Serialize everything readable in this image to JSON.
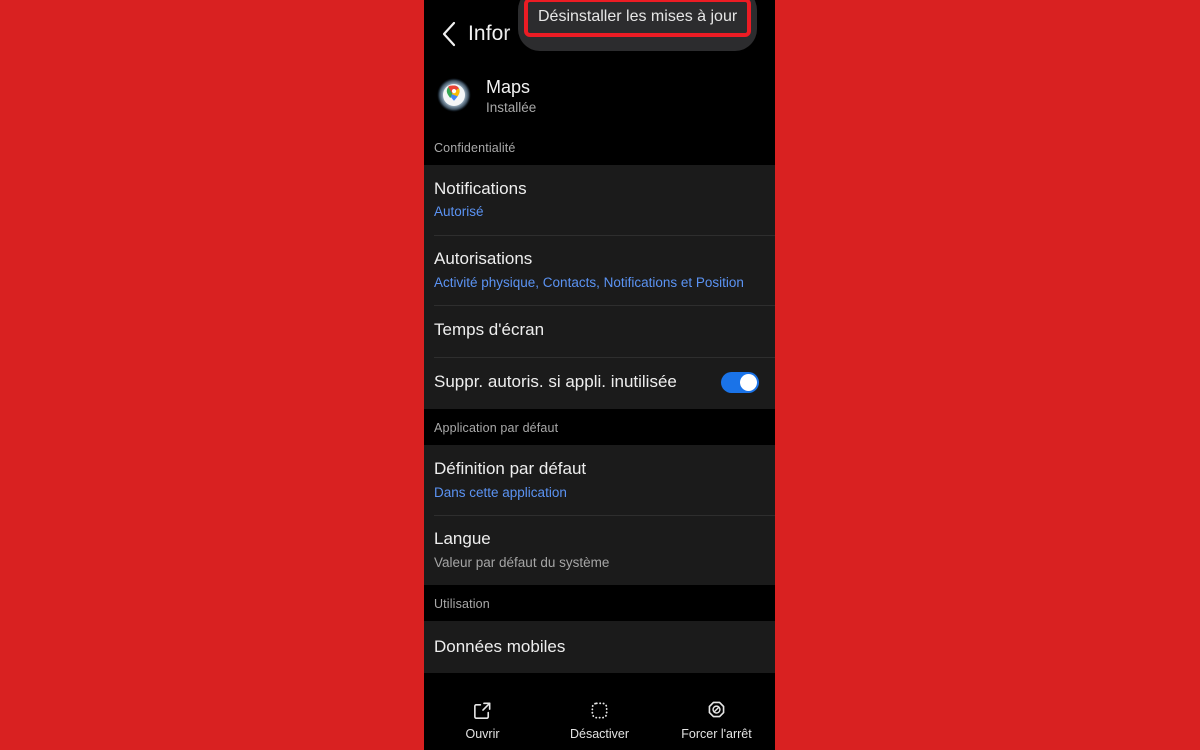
{
  "background_color": "#d92121",
  "accent_blue": "#5b93f3",
  "toggle_color": "#1a73e8",
  "highlight_color": "#ec1c24",
  "appbar": {
    "back_icon": "chevron-left-icon",
    "title": "Infor"
  },
  "popup": {
    "items": [
      {
        "label": "Désinstaller les mises à jour",
        "highlighted": true
      }
    ]
  },
  "app": {
    "icon": "google-maps-icon",
    "name": "Maps",
    "state": "Installée"
  },
  "sections": [
    {
      "header": "Confidentialité",
      "rows": [
        {
          "title": "Notifications",
          "subtitle": "Autorisé",
          "subtitle_style": "blue",
          "control": "none"
        },
        {
          "title": "Autorisations",
          "subtitle": "Activité physique, Contacts, Notifications et Position",
          "subtitle_style": "blue",
          "control": "none"
        },
        {
          "title": "Temps d'écran",
          "subtitle": "",
          "subtitle_style": "none",
          "control": "none"
        },
        {
          "title": "Suppr. autoris. si appli. inutilisée",
          "subtitle": "",
          "subtitle_style": "none",
          "control": "toggle",
          "toggle_on": true
        }
      ]
    },
    {
      "header": "Application par défaut",
      "rows": [
        {
          "title": "Définition par défaut",
          "subtitle": "Dans cette application",
          "subtitle_style": "blue",
          "control": "none"
        },
        {
          "title": "Langue",
          "subtitle": "Valeur par défaut du système",
          "subtitle_style": "grey",
          "control": "none"
        }
      ]
    },
    {
      "header": "Utilisation",
      "rows": [
        {
          "title": "Données mobiles",
          "subtitle": "",
          "subtitle_style": "none",
          "control": "none"
        }
      ]
    }
  ],
  "actionbar": {
    "actions": [
      {
        "icon": "open-external-icon",
        "label": "Ouvrir"
      },
      {
        "icon": "dashed-square-icon",
        "label": "Désactiver"
      },
      {
        "icon": "force-stop-icon",
        "label": "Forcer l'arrêt"
      }
    ]
  }
}
